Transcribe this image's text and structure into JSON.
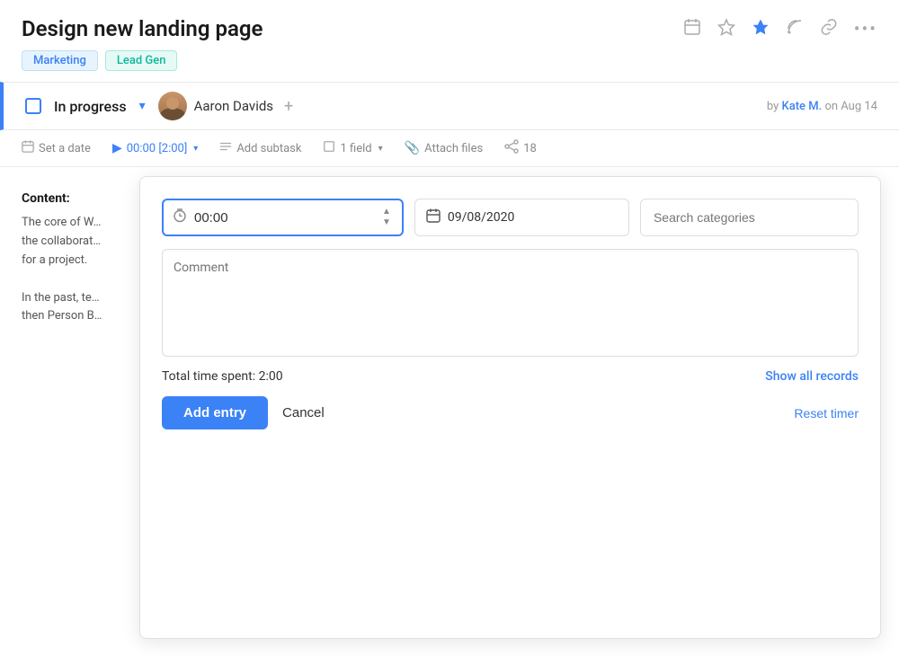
{
  "header": {
    "title": "Design new landing page",
    "icons": {
      "calendar": "📅",
      "star": "☆",
      "pin": "📌",
      "rss": "◉",
      "link": "🔗",
      "more": "..."
    }
  },
  "tags": [
    {
      "label": "Marketing",
      "type": "marketing"
    },
    {
      "label": "Lead Gen",
      "type": "leadgen"
    }
  ],
  "status": {
    "label": "In progress",
    "dropdown_icon": "▾",
    "assignee_name": "Aaron Davids",
    "add_icon": "+",
    "author_prefix": "by",
    "author": "Kate M.",
    "date_prefix": "on Aug 14"
  },
  "toolbar": {
    "set_date": "Set a date",
    "timer": "00:00 [2:00]",
    "add_subtask": "Add subtask",
    "field": "1 field",
    "attach_files": "Attach files",
    "share_count": "18"
  },
  "content": {
    "label": "Content:",
    "text1": "The core of W… the collaborat… for a project.",
    "text2": "In the past, te… then Person B…"
  },
  "modal": {
    "time_value": "00:00",
    "time_placeholder": "00:00",
    "date_value": "09/08/2020",
    "search_placeholder": "Search categories",
    "comment_placeholder": "Comment",
    "total_label": "Total time spent: 2:00",
    "show_records": "Show all records",
    "add_label": "Add entry",
    "cancel_label": "Cancel",
    "reset_label": "Reset timer"
  }
}
